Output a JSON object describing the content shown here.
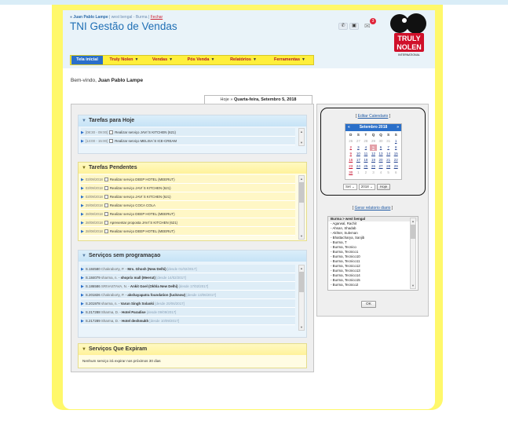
{
  "header": {
    "user_name": "Juan Pablo Lampe",
    "location": "| west bengal - Burma |",
    "logout_label": "Fechar",
    "app_title": "TNI Gestão de Vendas",
    "mail_count": "3",
    "logo_line1": "TRULY",
    "logo_line2": "NOLEN",
    "logo_line3": "INTERNATIONAL"
  },
  "nav": [
    {
      "label": "Tela inicial"
    },
    {
      "label": "Truly Nolen"
    },
    {
      "label": "Vendas"
    },
    {
      "label": "Pós Venda"
    },
    {
      "label": "Relatórios"
    },
    {
      "label": "Ferramentas"
    }
  ],
  "welcome": {
    "prefix": "Bem-vindo,",
    "name": "Juan Pablo Lampe"
  },
  "date_tab": {
    "prefix": "Hoje »",
    "date": "Quarta-feira, Setembro 5, 2018"
  },
  "today_tasks": {
    "title": "Tarefas para Hoje",
    "items": [
      {
        "time": "[08:30 - 09:00]",
        "text": "Realizar serviço JAVI´S KITCHEN (621)"
      },
      {
        "time": "[14:00 - 15:00]",
        "text": "Realizar serviço MELISA´S ICE-CREAM"
      }
    ]
  },
  "pending_tasks": {
    "title": "Tarefas Pendentes",
    "items": [
      {
        "date": "03/09/2018",
        "text": "Realizar serviço DEEP HOTEL (MEERUT)"
      },
      {
        "date": "03/09/2018",
        "text": "Realizar serviço JAVI´S KITCHEN (621)"
      },
      {
        "date": "03/09/2018",
        "text": "Realizar serviço JAVI´S KITCHEN (621)"
      },
      {
        "date": "29/08/2018",
        "text": "Realizar serviço COCA COLA"
      },
      {
        "date": "28/08/2018",
        "text": "Realizar serviço DEEP HOTEL (MEERUT)"
      },
      {
        "date": "28/08/2018",
        "text": "Apresentar proposta JAVI´S KITCHEN (621)"
      },
      {
        "date": "28/08/2018",
        "text": "Realizar serviço DEEP HOTEL (MEERUT)"
      }
    ]
  },
  "unscheduled": {
    "title": "Serviços sem programaçao",
    "items": [
      {
        "code": "S.184580",
        "who": "Chakraborty, P.",
        "name": "Mrs. Ghosh (New Delhi)",
        "since": "[desde 01/02/2017]"
      },
      {
        "code": "S.184079",
        "who": "sharma, n.",
        "name": "shoprix mall (Meerut)",
        "since": "[desde 14/02/2017]"
      },
      {
        "code": "S.186586",
        "who": "SRIVASTAVA, N.",
        "name": "Ankit Goel (Okhla New Delhi)",
        "since": "[desde 17/02/2017]"
      },
      {
        "code": "S.201826",
        "who": "Chakraborty, P.",
        "name": "akshayapatra foundation (lucknow)",
        "since": "[desde 13/06/2017]"
      },
      {
        "code": "S.201978",
        "who": "sharma, n.",
        "name": "Varun Singh Solanki",
        "since": "[desde 20/06/2017]"
      },
      {
        "code": "S.217288",
        "who": "Sharma, D.",
        "name": "Hotel Paradise",
        "since": "[desde 09/09/2017]"
      },
      {
        "code": "S.217289",
        "who": "Sharma, D.",
        "name": "Hotel deshmukh",
        "since": "[desde 10/09/2017]"
      }
    ]
  },
  "expiring": {
    "title": "Serviços Que Expiram",
    "notice": "Nenhum serviço irá expirar nos próximos 30 dias"
  },
  "calendar": {
    "edit_label": "Editar Calendario",
    "month_title": "Setembro 2018",
    "prev": "«",
    "next": "»",
    "weekdays": [
      "D",
      "S",
      "T",
      "Q",
      "Q",
      "S",
      "S"
    ],
    "weeks": [
      [
        "26",
        "27",
        "28",
        "29",
        "30",
        "31",
        "1"
      ],
      [
        "2",
        "3",
        "4",
        "5",
        "6",
        "7",
        "8"
      ],
      [
        "9",
        "10",
        "11",
        "12",
        "13",
        "14",
        "15"
      ],
      [
        "16",
        "17",
        "18",
        "19",
        "20",
        "21",
        "22"
      ],
      [
        "23",
        "24",
        "25",
        "26",
        "27",
        "28",
        "29"
      ],
      [
        "30",
        "1",
        "2",
        "3",
        "4",
        "5",
        "6"
      ]
    ],
    "today": "5",
    "month_select": "Set",
    "year_select": "2018",
    "today_button": "Hoje"
  },
  "report": {
    "label": "Gerar relatorio diario",
    "list": [
      "Burma > west bengal",
      "- Agarwal, Rachit",
      "- Ahsan, Shadab",
      "- Akhter, Suleman",
      "- Bhattacharya, Sanjib",
      "- Burma, T",
      "- Burma, Tecnico",
      "- Burma, Tecnico1",
      "- Burma, Tecnico10",
      "- Burma, Tecnico11",
      "- Burma, Tecnico12",
      "- Burma, Tecnico13",
      "- Burma, Tecnico14",
      "- Burma, Tecnico15",
      "- Burma, Tecnico2"
    ],
    "ok_label": "OK"
  },
  "colors": {
    "frame": "#fff86a",
    "nav_bar": "#ffef3c",
    "nav_active": "#2a6fc9",
    "title_blue": "#1f6fb5",
    "badge_red": "#e0243a"
  }
}
